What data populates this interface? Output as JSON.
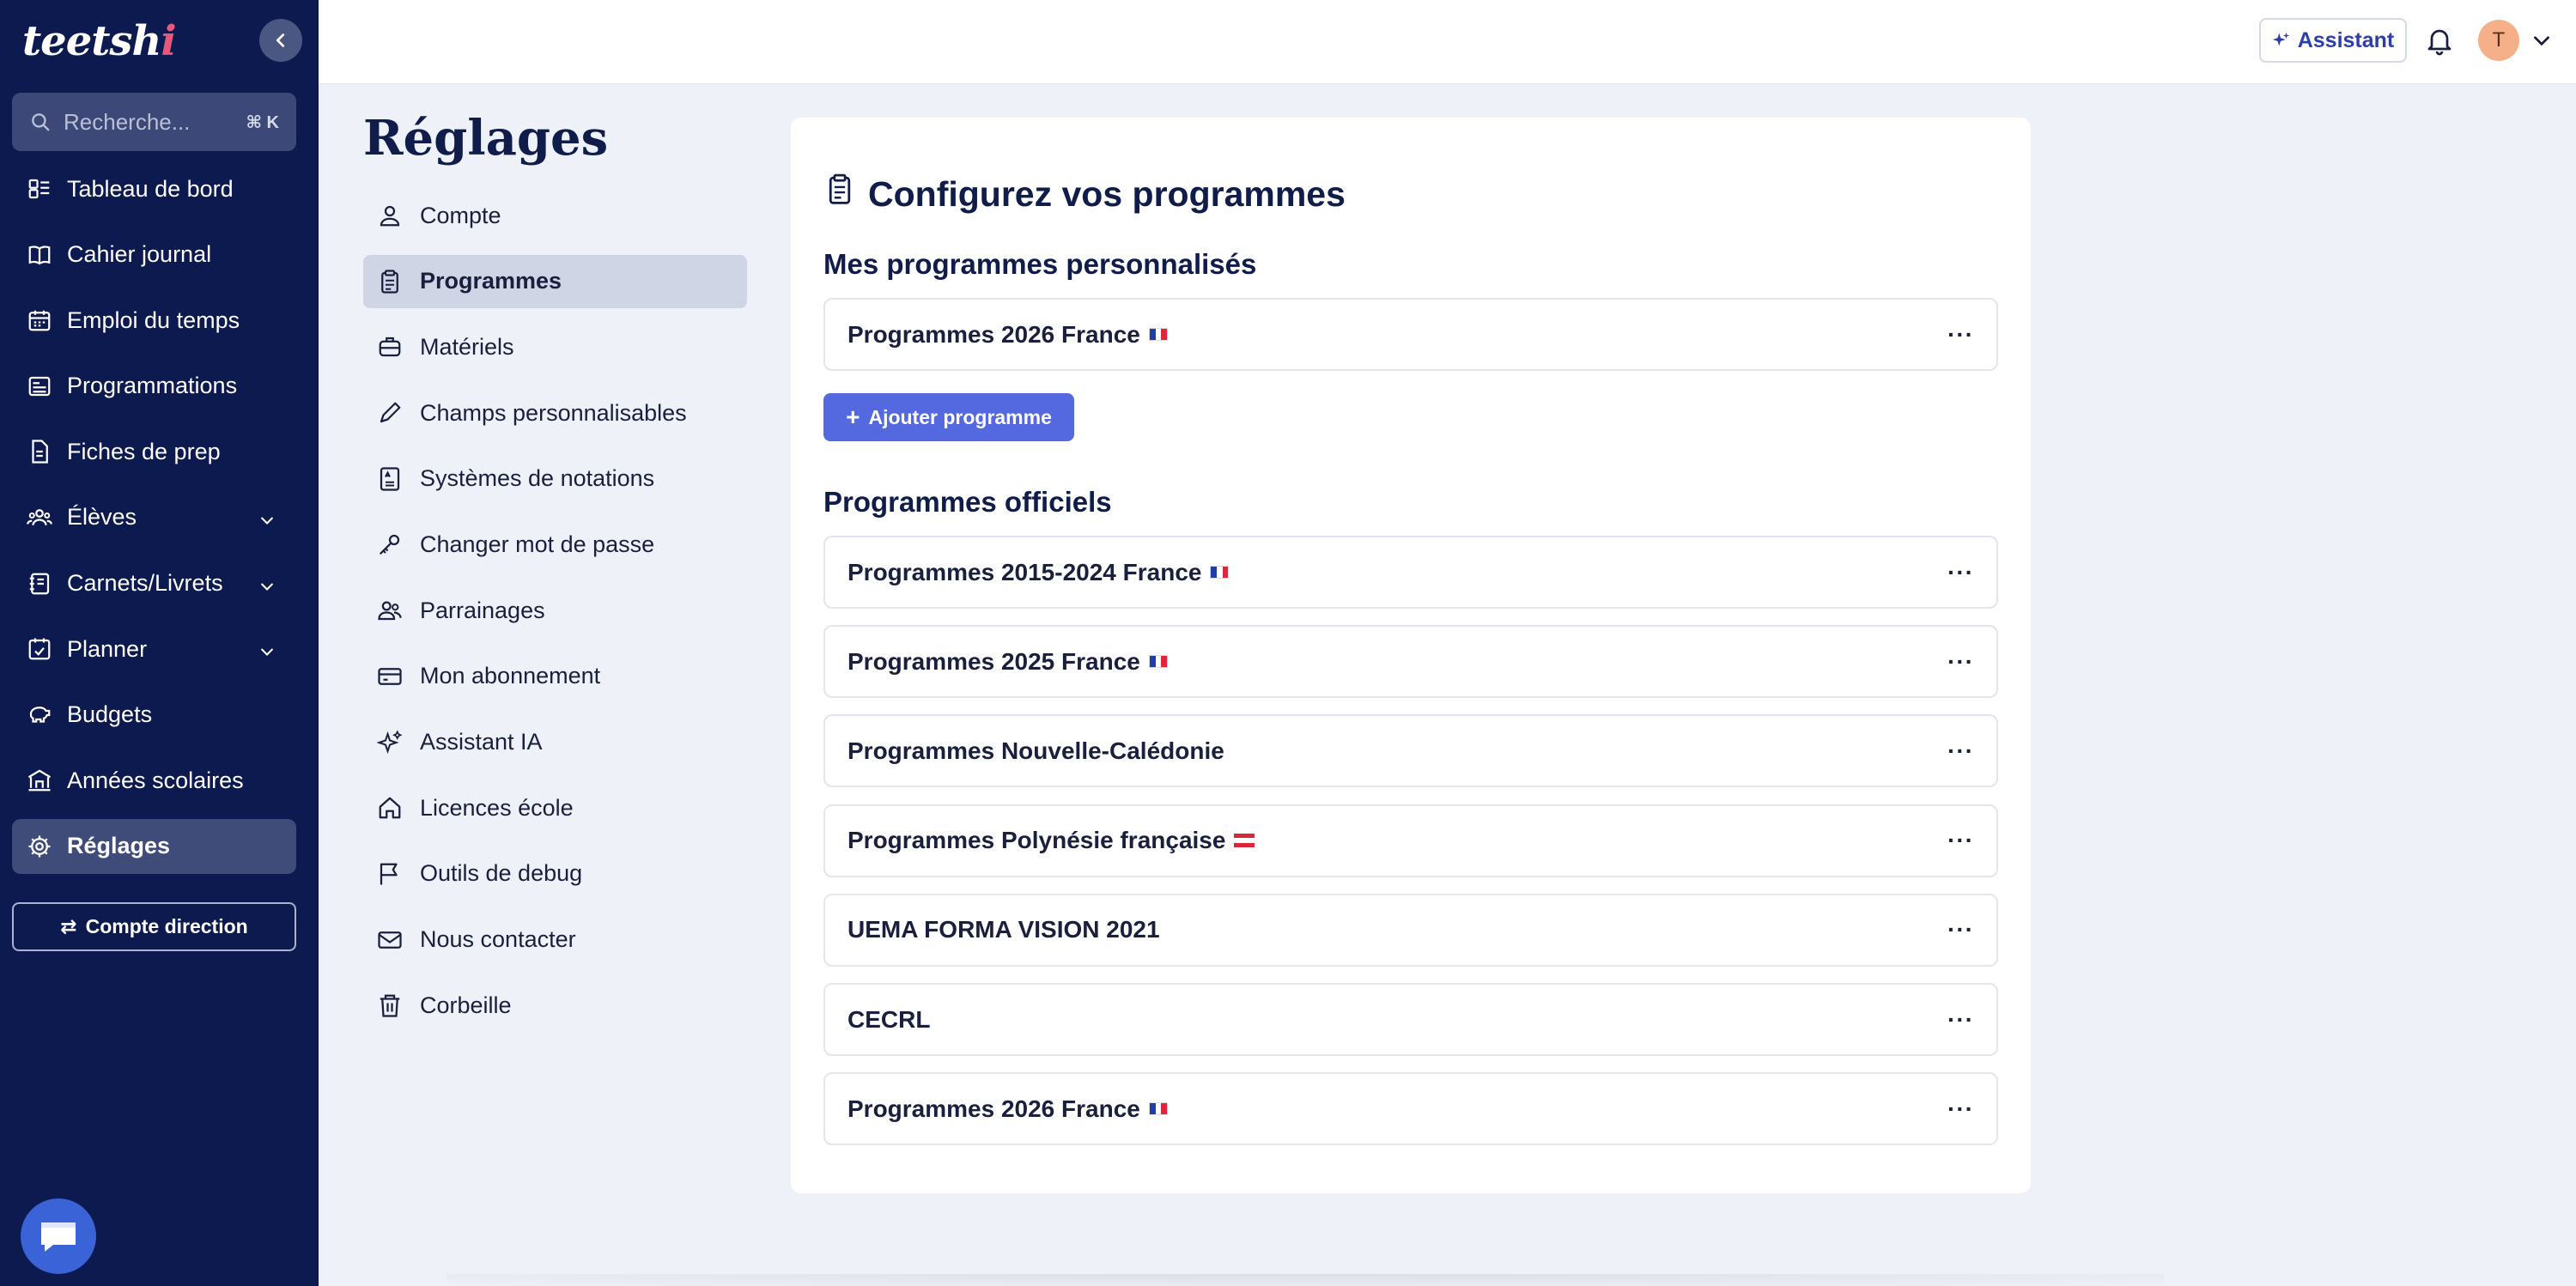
{
  "app": {
    "logo_text": "teetsh",
    "logo_dot": "i"
  },
  "search": {
    "placeholder": "Recherche...",
    "shortcut": "⌘ K"
  },
  "sidebar": {
    "items": [
      {
        "label": "Tableau de bord",
        "icon": "dashboard-icon",
        "has_chevron": false,
        "active": false
      },
      {
        "label": "Cahier journal",
        "icon": "book-icon",
        "has_chevron": false,
        "active": false
      },
      {
        "label": "Emploi du temps",
        "icon": "calendar-icon",
        "has_chevron": false,
        "active": false
      },
      {
        "label": "Programmations",
        "icon": "list-icon",
        "has_chevron": false,
        "active": false
      },
      {
        "label": "Fiches de prep",
        "icon": "document-icon",
        "has_chevron": false,
        "active": false
      },
      {
        "label": "Élèves",
        "icon": "users-icon",
        "has_chevron": true,
        "active": false
      },
      {
        "label": "Carnets/Livrets",
        "icon": "notebook-icon",
        "has_chevron": true,
        "active": false
      },
      {
        "label": "Planner",
        "icon": "planner-icon",
        "has_chevron": true,
        "active": false
      },
      {
        "label": "Budgets",
        "icon": "piggy-bank-icon",
        "has_chevron": false,
        "active": false
      },
      {
        "label": "Années scolaires",
        "icon": "school-icon",
        "has_chevron": false,
        "active": false
      },
      {
        "label": "Réglages",
        "icon": "gear-icon",
        "has_chevron": false,
        "active": true
      }
    ],
    "compte_direction": "Compte direction"
  },
  "topbar": {
    "assistant_label": "Assistant",
    "avatar_initial": "T"
  },
  "settings": {
    "title": "Réglages",
    "items": [
      {
        "label": "Compte",
        "icon": "user-icon",
        "active": false
      },
      {
        "label": "Programmes",
        "icon": "clipboard-icon",
        "active": true
      },
      {
        "label": "Matériels",
        "icon": "briefcase-icon",
        "active": false
      },
      {
        "label": "Champs personnalisables",
        "icon": "pencil-icon",
        "active": false
      },
      {
        "label": "Systèmes de notations",
        "icon": "grading-icon",
        "active": false
      },
      {
        "label": "Changer mot de passe",
        "icon": "key-icon",
        "active": false
      },
      {
        "label": "Parrainages",
        "icon": "referral-icon",
        "active": false
      },
      {
        "label": "Mon abonnement",
        "icon": "credit-card-icon",
        "active": false
      },
      {
        "label": "Assistant IA",
        "icon": "sparkles-icon",
        "active": false
      },
      {
        "label": "Licences école",
        "icon": "home-icon",
        "active": false
      },
      {
        "label": "Outils de debug",
        "icon": "flag-icon",
        "active": false
      },
      {
        "label": "Nous contacter",
        "icon": "mail-icon",
        "active": false
      },
      {
        "label": "Corbeille",
        "icon": "trash-icon",
        "active": false
      }
    ]
  },
  "main": {
    "title": "Configurez vos programmes",
    "custom_section": {
      "title": "Mes programmes personnalisés",
      "programs": [
        {
          "name": "Programmes 2026 France",
          "flag": "fr"
        }
      ],
      "add_label": "Ajouter programme"
    },
    "official_section": {
      "title": "Programmes officiels",
      "programs": [
        {
          "name": "Programmes 2015-2024 France",
          "flag": "fr"
        },
        {
          "name": "Programmes 2025 France",
          "flag": "fr"
        },
        {
          "name": "Programmes Nouvelle-Calédonie",
          "flag": ""
        },
        {
          "name": "Programmes Polynésie française",
          "flag": "pf"
        },
        {
          "name": "UEMA FORMA VISION 2021",
          "flag": ""
        },
        {
          "name": "CECRL",
          "flag": ""
        },
        {
          "name": "Programmes 2026 France",
          "flag": "fr"
        }
      ]
    },
    "more_label": "···"
  },
  "colors": {
    "sidebar_bg": "#0d1a4f",
    "accent": "#5468e0",
    "page_bg": "#eef1f8"
  }
}
